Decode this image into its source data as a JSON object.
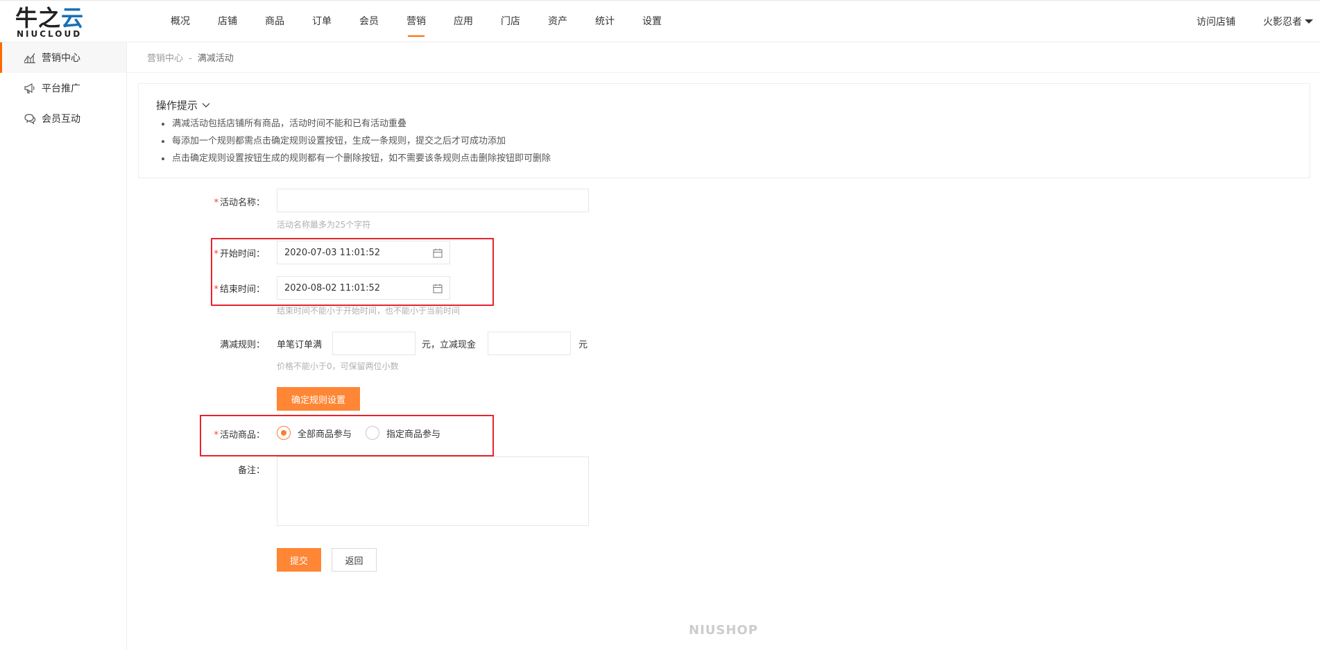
{
  "logo": {
    "mark_text": "牛之",
    "mark_cloud": "云",
    "sub_text": "NIUCLOUD"
  },
  "nav": {
    "items": [
      {
        "label": "概况"
      },
      {
        "label": "店铺"
      },
      {
        "label": "商品"
      },
      {
        "label": "订单"
      },
      {
        "label": "会员"
      },
      {
        "label": "营销"
      },
      {
        "label": "应用"
      },
      {
        "label": "门店"
      },
      {
        "label": "资产"
      },
      {
        "label": "统计"
      },
      {
        "label": "设置"
      }
    ],
    "active": "营销"
  },
  "header": {
    "visit_store": "访问店铺",
    "username": "火影忍者"
  },
  "sidebar": {
    "items": [
      {
        "label": "营销中心",
        "icon": "chart-icon"
      },
      {
        "label": "平台推广",
        "icon": "megaphone-icon"
      },
      {
        "label": "会员互动",
        "icon": "chat-icon"
      }
    ]
  },
  "breadcrumb": {
    "parent": "营销中心",
    "separator": "-",
    "current": "满减活动"
  },
  "tips": {
    "title": "操作提示",
    "items": [
      "满减活动包括店铺所有商品，活动时间不能和已有活动重叠",
      "每添加一个规则都需点击确定规则设置按钮，生成一条规则，提交之后才可成功添加",
      "点击确定规则设置按钮生成的规则都有一个删除按钮，如不需要该条规则点击删除按钮即可删除"
    ]
  },
  "form": {
    "required_mark": "*",
    "name_label": "活动名称：",
    "name_value": "",
    "name_hint": "活动名称最多为25个字符",
    "start_label": "开始时间：",
    "start_value": "2020-07-03 11:01:52",
    "end_label": "结束时间：",
    "end_value": "2020-08-02 11:01:52",
    "time_hint": "结束时间不能小于开始时间，也不能小于当前时间",
    "rule_label": "满减规则：",
    "rule_prefix": "单笔订单满",
    "rule_mid": "元，立减现金",
    "rule_suffix": "元",
    "rule_hint": "价格不能小于0，可保留两位小数",
    "rule_button": "确定规则设置",
    "goods_label": "活动商品：",
    "goods_options": [
      {
        "label": "全部商品参与",
        "checked": true
      },
      {
        "label": "指定商品参与",
        "checked": false
      }
    ],
    "remark_label": "备注：",
    "submit": "提交",
    "back": "返回"
  },
  "footer": {
    "brand": "NIUSHOP"
  },
  "colors": {
    "accent": "#ff6a00",
    "button": "#ff8635",
    "highlight_box": "#e8232a"
  }
}
